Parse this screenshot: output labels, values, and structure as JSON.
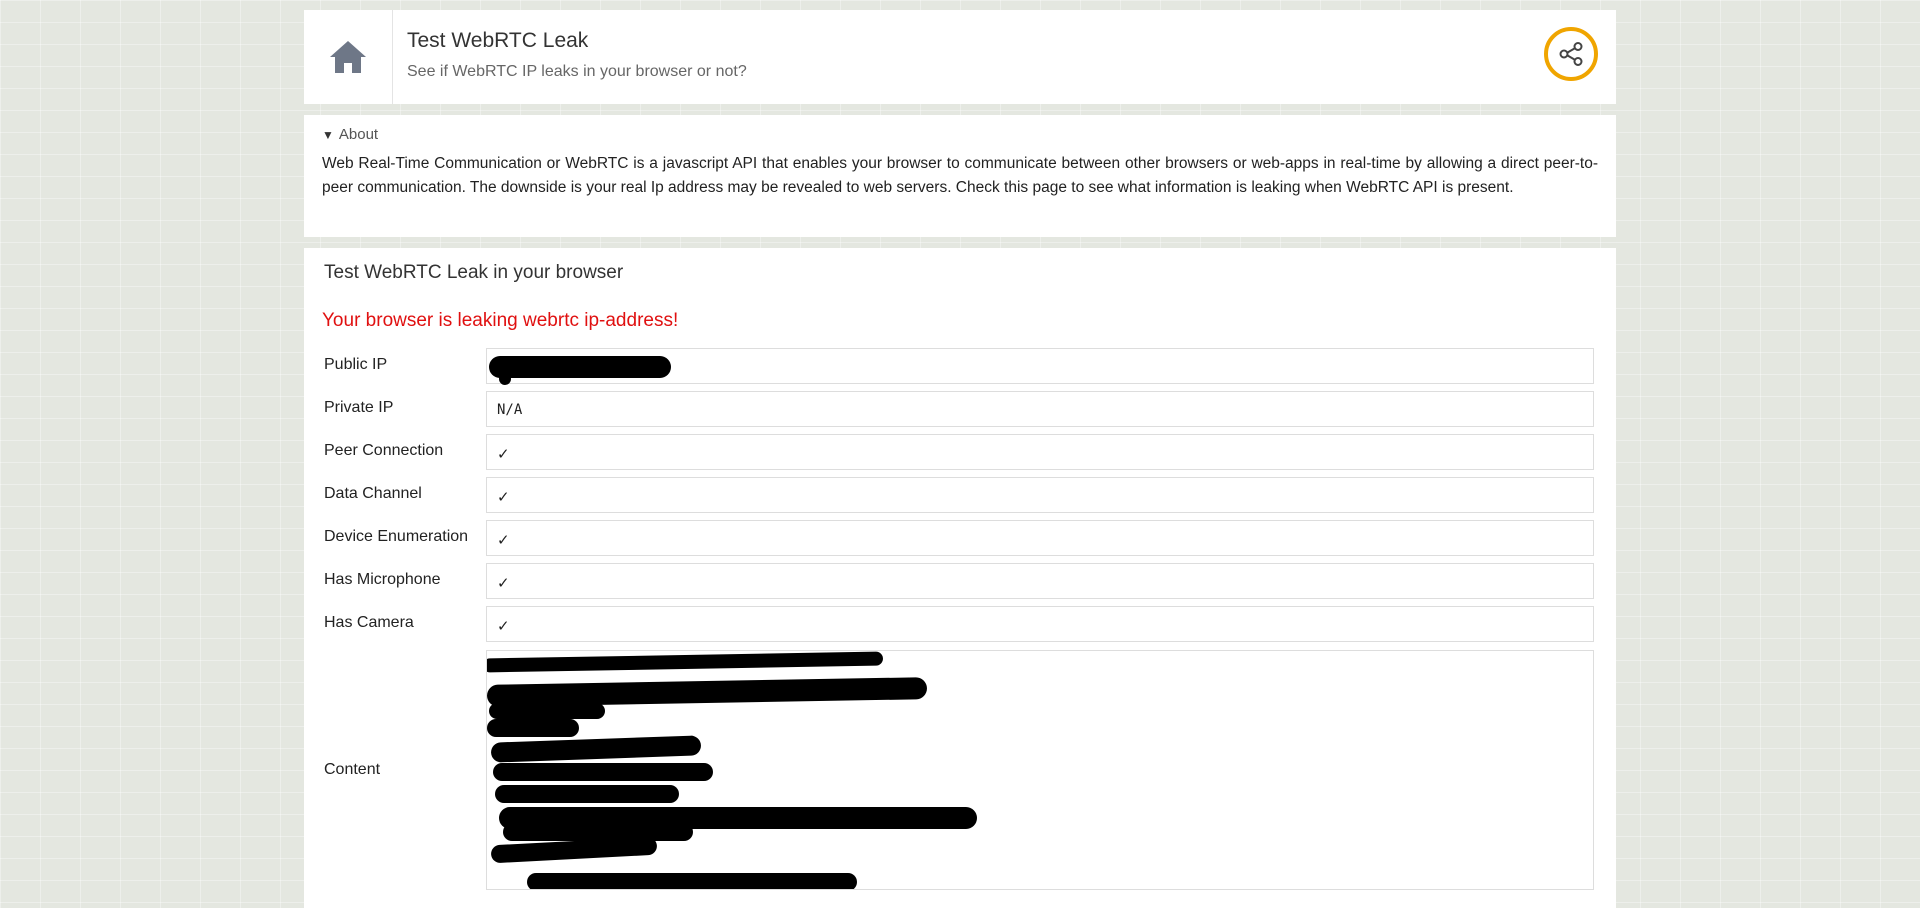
{
  "header": {
    "title": "Test WebRTC Leak",
    "subtitle": "See if WebRTC IP leaks in your browser or not?",
    "home_icon": "home-icon",
    "share_icon": "share-icon",
    "accent_color": "#f0a500"
  },
  "about": {
    "summary": "About",
    "text": "Web Real-Time Communication or WebRTC is a javascript API that enables your browser to communicate between other browsers or web-apps in real-time by allowing a direct peer-to-peer communication. The downside is your real Ip address may be revealed to web servers. Check this page to see what information is leaking when WebRTC API is present."
  },
  "test": {
    "section_title": "Test WebRTC Leak in your browser",
    "alert": "Your browser is leaking webrtc ip-address!",
    "alert_color": "#e01010",
    "rows": [
      {
        "label": "Public IP",
        "value": ""
      },
      {
        "label": "Private IP",
        "value": "N/A"
      },
      {
        "label": "Peer Connection",
        "value": "✓"
      },
      {
        "label": "Data Channel",
        "value": "✓"
      },
      {
        "label": "Device Enumeration",
        "value": "✓"
      },
      {
        "label": "Has Microphone",
        "value": "✓"
      },
      {
        "label": "Has Camera",
        "value": "✓"
      }
    ],
    "content_label": "Content"
  }
}
